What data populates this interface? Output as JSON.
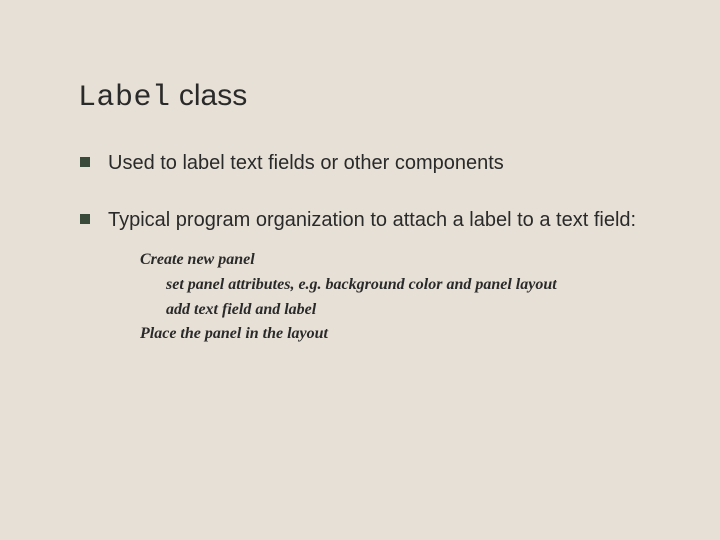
{
  "title": {
    "code": "Label",
    "rest": " class"
  },
  "bullets": [
    "Used to label text fields or other components",
    "Typical program organization to attach a label to a text field:"
  ],
  "steps": {
    "line1": "Create new panel",
    "line2": "set panel attributes, e.g. background color and panel layout",
    "line3": "add text field and label",
    "line4": "Place the panel in the layout"
  }
}
